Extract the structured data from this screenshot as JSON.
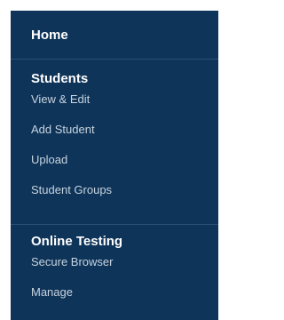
{
  "nav": {
    "home_label": "Home",
    "sections": [
      {
        "heading": "Students",
        "items": [
          "View & Edit",
          "Add Student",
          "Upload",
          "Student Groups"
        ]
      },
      {
        "heading": "Online Testing",
        "items": [
          "Secure Browser",
          "Manage"
        ]
      }
    ]
  },
  "colors": {
    "panel_background": "#0e3459",
    "heading_text": "#ffffff",
    "item_text": "#c8d3df",
    "divider": "#2c4f73"
  }
}
